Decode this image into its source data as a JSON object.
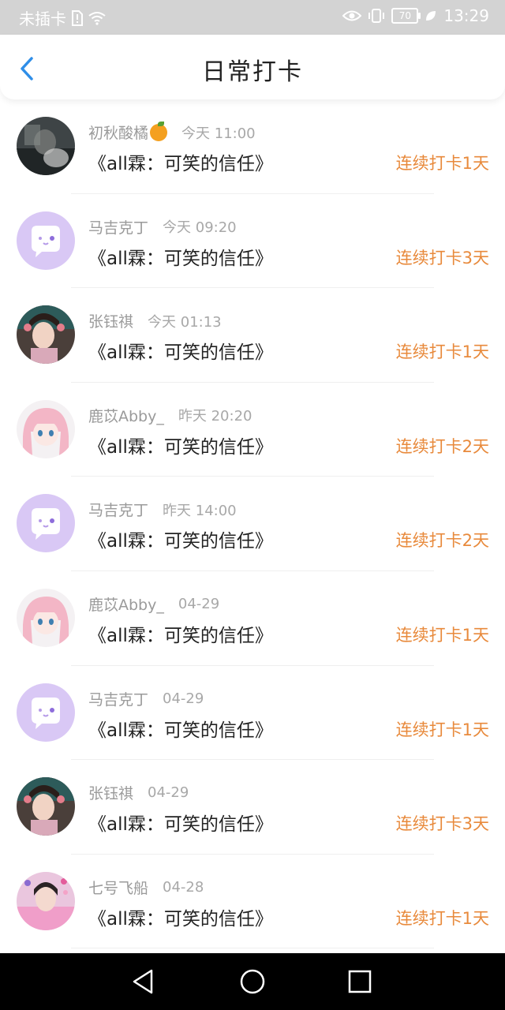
{
  "status_bar": {
    "carrier": "未插卡",
    "battery": "70",
    "time": "13:29"
  },
  "header": {
    "title": "日常打卡"
  },
  "colors": {
    "accent": "#e88a3c",
    "back": "#2f8ee8",
    "avatar_purple": "#d9c8f5"
  },
  "items": [
    {
      "name": "初秋酸橘",
      "emoji": "orange",
      "time": "今天 11:00",
      "content": "《all霖：可笑的信任》",
      "streak": "连续打卡1天",
      "avatar": "photo-dark"
    },
    {
      "name": "马吉克丁",
      "time": "今天 09:20",
      "content": "《all霖：可笑的信任》",
      "streak": "连续打卡3天",
      "avatar": "default-purple"
    },
    {
      "name": "张钰祺",
      "time": "今天 01:13",
      "content": "《all霖：可笑的信任》",
      "streak": "连续打卡1天",
      "avatar": "photo-girl"
    },
    {
      "name": "鹿苡Abby_",
      "time": "昨天 20:20",
      "content": "《all霖：可笑的信任》",
      "streak": "连续打卡2天",
      "avatar": "anime-pink"
    },
    {
      "name": "马吉克丁",
      "time": "昨天 14:00",
      "content": "《all霖：可笑的信任》",
      "streak": "连续打卡2天",
      "avatar": "default-purple"
    },
    {
      "name": "鹿苡Abby_",
      "time": "04-29",
      "content": "《all霖：可笑的信任》",
      "streak": "连续打卡1天",
      "avatar": "anime-pink"
    },
    {
      "name": "马吉克丁",
      "time": "04-29",
      "content": "《all霖：可笑的信任》",
      "streak": "连续打卡1天",
      "avatar": "default-purple"
    },
    {
      "name": "张钰祺",
      "time": "04-29",
      "content": "《all霖：可笑的信任》",
      "streak": "连续打卡3天",
      "avatar": "photo-girl"
    },
    {
      "name": "七号飞船",
      "time": "04-28",
      "content": "《all霖：可笑的信任》",
      "streak": "连续打卡1天",
      "avatar": "photo-pink"
    }
  ],
  "nav": {
    "icons": [
      "back-triangle-icon",
      "home-circle-icon",
      "recents-square-icon"
    ]
  }
}
